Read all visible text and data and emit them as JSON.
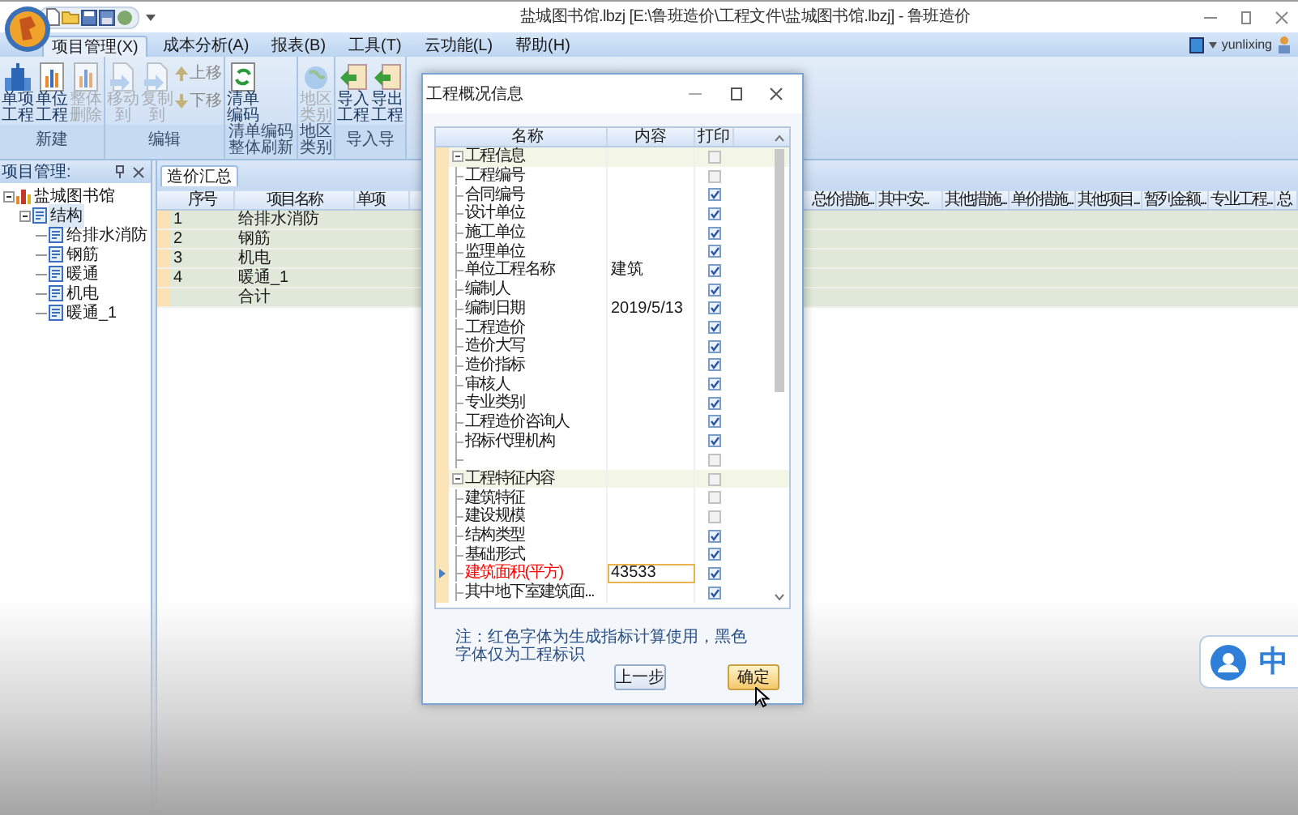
{
  "window": {
    "title": "盐城图书馆.lbzj [E:\\鲁班造价\\工程文件\\盐城图书馆.lbzj] - 鲁班造价",
    "user": "yunlixing"
  },
  "menu_tabs": [
    {
      "label": "项目管理(X)",
      "selected": true
    },
    {
      "label": "成本分析(A)",
      "selected": false
    },
    {
      "label": "报表(B)",
      "selected": false
    },
    {
      "label": "工具(T)",
      "selected": false
    },
    {
      "label": "云功能(L)",
      "selected": false
    },
    {
      "label": "帮助(H)",
      "selected": false
    }
  ],
  "ribbon_groups": [
    {
      "label": "新建",
      "buttons": [
        {
          "label": "单项工程",
          "kind": "large",
          "disabled": false
        },
        {
          "label": "单位工程",
          "kind": "large",
          "disabled": false
        },
        {
          "label": "整体删除",
          "kind": "large",
          "disabled": true
        }
      ]
    },
    {
      "label": "编辑",
      "buttons": [
        {
          "label": "移动到",
          "kind": "large",
          "disabled": true
        },
        {
          "label": "复制到",
          "kind": "large",
          "disabled": true
        },
        {
          "label": "上移",
          "kind": "small",
          "disabled": true
        },
        {
          "label": "下移",
          "kind": "small",
          "disabled": true
        }
      ]
    },
    {
      "label": "清单编码整体刷新",
      "buttons": [
        {
          "label": "清单编码",
          "kind": "large",
          "disabled": false
        }
      ]
    },
    {
      "label": "地区类别",
      "buttons": [
        {
          "label": "地区类别",
          "kind": "large",
          "disabled": true
        }
      ]
    },
    {
      "label": "导入导",
      "buttons": [
        {
          "label": "导入工程",
          "kind": "large",
          "disabled": false
        },
        {
          "label": "导出工程",
          "kind": "large",
          "disabled": false
        }
      ]
    }
  ],
  "project_panel": {
    "title": "项目管理:",
    "tree": [
      {
        "label": "盐城图书馆",
        "selected": false,
        "children": [
          {
            "label": "结构",
            "selected": true,
            "children": [
              {
                "label": "给排水消防",
                "selected": false
              },
              {
                "label": "钢筋",
                "selected": false
              },
              {
                "label": "暖通",
                "selected": false
              },
              {
                "label": "机电",
                "selected": false
              },
              {
                "label": "暖通_1",
                "selected": false
              }
            ]
          }
        ]
      }
    ]
  },
  "document_tabs": [
    {
      "label": "造价汇总",
      "selected": true
    }
  ],
  "table": {
    "columns": [
      "序号",
      "项目名称",
      "单项",
      "总价措施...",
      "其中:安...",
      "其他措施...",
      "单价措施...",
      "其他项目...",
      "暂列金额...",
      "专业工程...",
      "总"
    ],
    "rows": [
      {
        "cells": [
          "1",
          "给排水消防"
        ]
      },
      {
        "cells": [
          "2",
          "钢筋"
        ]
      },
      {
        "cells": [
          "3",
          "机电"
        ]
      },
      {
        "cells": [
          "4",
          "暖通_1"
        ]
      },
      {
        "cells": [
          "",
          "合计"
        ]
      }
    ]
  },
  "dialog": {
    "title": "工程概况信息",
    "columns": [
      "名称",
      "内容",
      "打印"
    ],
    "rows": [
      {
        "kind": "group",
        "name": "工程信息",
        "content": "",
        "print": false,
        "red": false,
        "current": false
      },
      {
        "kind": "item",
        "name": "工程编号",
        "content": "",
        "print": false,
        "red": false,
        "current": false
      },
      {
        "kind": "item",
        "name": "合同编号",
        "content": "",
        "print": true,
        "red": false,
        "current": false
      },
      {
        "kind": "item",
        "name": "设计单位",
        "content": "",
        "print": true,
        "red": false,
        "current": false
      },
      {
        "kind": "item",
        "name": "施工单位",
        "content": "",
        "print": true,
        "red": false,
        "current": false
      },
      {
        "kind": "item",
        "name": "监理单位",
        "content": "",
        "print": true,
        "red": false,
        "current": false
      },
      {
        "kind": "item",
        "name": "单位工程名称",
        "content": "建筑",
        "print": true,
        "red": false,
        "current": false
      },
      {
        "kind": "item",
        "name": "编制人",
        "content": "",
        "print": true,
        "red": false,
        "current": false
      },
      {
        "kind": "item",
        "name": "编制日期",
        "content": "2019/5/13",
        "print": true,
        "red": false,
        "current": false
      },
      {
        "kind": "item",
        "name": "工程造价",
        "content": "",
        "print": true,
        "red": false,
        "current": false
      },
      {
        "kind": "item",
        "name": "造价大写",
        "content": "",
        "print": true,
        "red": false,
        "current": false
      },
      {
        "kind": "item",
        "name": "造价指标",
        "content": "",
        "print": true,
        "red": false,
        "current": false
      },
      {
        "kind": "item",
        "name": "审核人",
        "content": "",
        "print": true,
        "red": false,
        "current": false
      },
      {
        "kind": "item",
        "name": "专业类别",
        "content": "",
        "print": true,
        "red": false,
        "current": false
      },
      {
        "kind": "item",
        "name": "工程造价咨询人",
        "content": "",
        "print": true,
        "red": false,
        "current": false
      },
      {
        "kind": "item",
        "name": "招标代理机构",
        "content": "",
        "print": true,
        "red": false,
        "current": false
      },
      {
        "kind": "item",
        "name": "",
        "content": "",
        "print": false,
        "current": false
      },
      {
        "kind": "group",
        "name": "工程特征内容",
        "content": "",
        "print": false,
        "red": false,
        "current": false
      },
      {
        "kind": "item",
        "name": "建筑特征",
        "content": "",
        "print": false,
        "red": false,
        "current": false
      },
      {
        "kind": "item",
        "name": "建设规模",
        "content": "",
        "print": false,
        "red": false,
        "current": false
      },
      {
        "kind": "item",
        "name": "结构类型",
        "content": "",
        "print": true,
        "red": false,
        "current": false
      },
      {
        "kind": "item",
        "name": "基础形式",
        "content": "",
        "print": true,
        "red": false,
        "current": false
      },
      {
        "kind": "item",
        "name": "建筑面积(平方)",
        "content": "43533",
        "print": true,
        "red": true,
        "current": true
      },
      {
        "kind": "item",
        "name": "其中地下室建筑面...",
        "content": "",
        "print": true,
        "red": false,
        "current": false
      }
    ],
    "note": "注：红色字体为生成指标计算使用，黑色字体仅为工程标识",
    "buttons": [
      {
        "label": "上一步",
        "default": false
      },
      {
        "label": "确定",
        "default": true
      }
    ]
  },
  "chat_widget": {
    "label": "中"
  }
}
